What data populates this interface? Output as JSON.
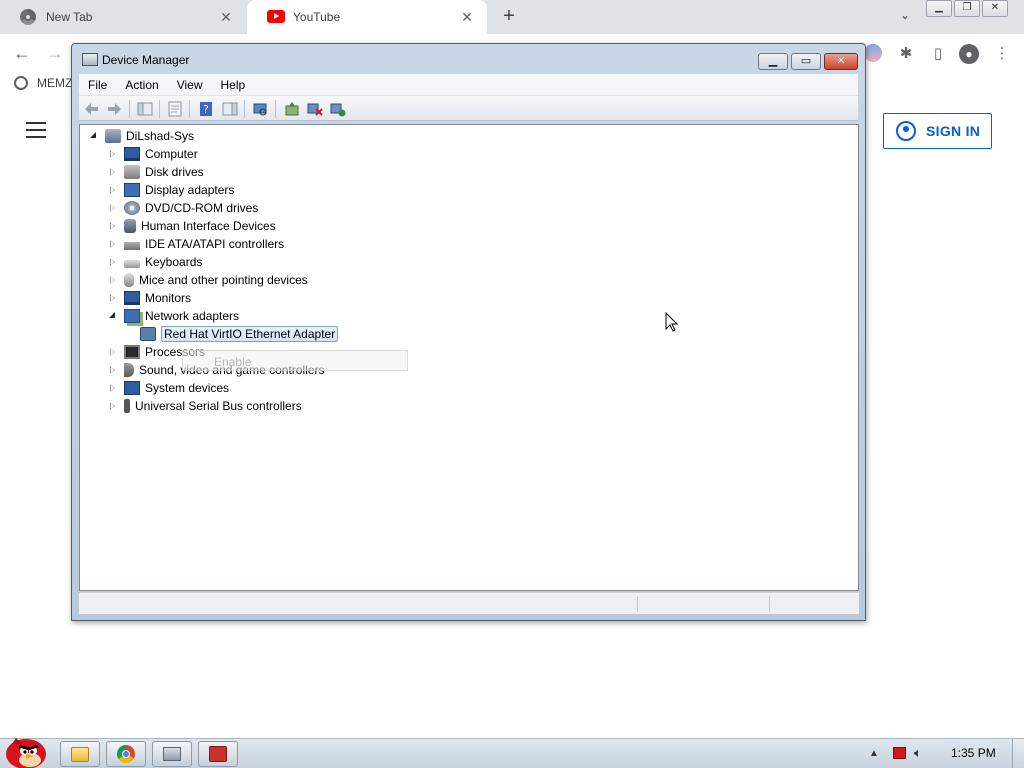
{
  "browser": {
    "tabs": [
      {
        "label": "New Tab",
        "icon": "chrome-icon"
      },
      {
        "label": "YouTube",
        "icon": "youtube-icon",
        "active": true
      }
    ],
    "bookmark": "MEMZ",
    "page": {
      "sign_in_label": "SIGN IN",
      "accent_color": "#065fd4"
    }
  },
  "device_manager": {
    "title": "Device Manager",
    "menu": [
      "File",
      "Action",
      "View",
      "Help"
    ],
    "root": "DiLshad-Sys",
    "items": [
      {
        "label": "Computer",
        "icon": "computer-icon",
        "expanded": false
      },
      {
        "label": "Disk drives",
        "icon": "disk-drive-icon",
        "expanded": false
      },
      {
        "label": "Display adapters",
        "icon": "display-adapter-icon",
        "expanded": false
      },
      {
        "label": "DVD/CD-ROM drives",
        "icon": "dvd-drive-icon",
        "expanded": false
      },
      {
        "label": "Human Interface Devices",
        "icon": "hid-icon",
        "expanded": false
      },
      {
        "label": "IDE ATA/ATAPI controllers",
        "icon": "ide-controller-icon",
        "expanded": false
      },
      {
        "label": "Keyboards",
        "icon": "keyboard-icon",
        "expanded": false
      },
      {
        "label": "Mice and other pointing devices",
        "icon": "mouse-icon",
        "expanded": false
      },
      {
        "label": "Monitors",
        "icon": "monitor-icon",
        "expanded": false
      },
      {
        "label": "Network adapters",
        "icon": "network-adapter-icon",
        "expanded": true,
        "children": [
          {
            "label": "Red Hat VirtIO Ethernet Adapter",
            "icon": "ethernet-adapter-icon",
            "selected": true
          }
        ]
      },
      {
        "label": "Processors",
        "icon": "processor-icon",
        "expanded": false
      },
      {
        "label": "Sound, video and game controllers",
        "icon": "sound-icon",
        "expanded": false
      },
      {
        "label": "System devices",
        "icon": "system-device-icon",
        "expanded": false
      },
      {
        "label": "Universal Serial Bus controllers",
        "icon": "usb-icon",
        "expanded": false
      }
    ],
    "context_menu_ghost": "Enable"
  },
  "taskbar": {
    "clock": "1:35 PM",
    "apps": [
      "explorer-icon",
      "chrome-icon",
      "device-manager-icon",
      "app-icon"
    ]
  }
}
